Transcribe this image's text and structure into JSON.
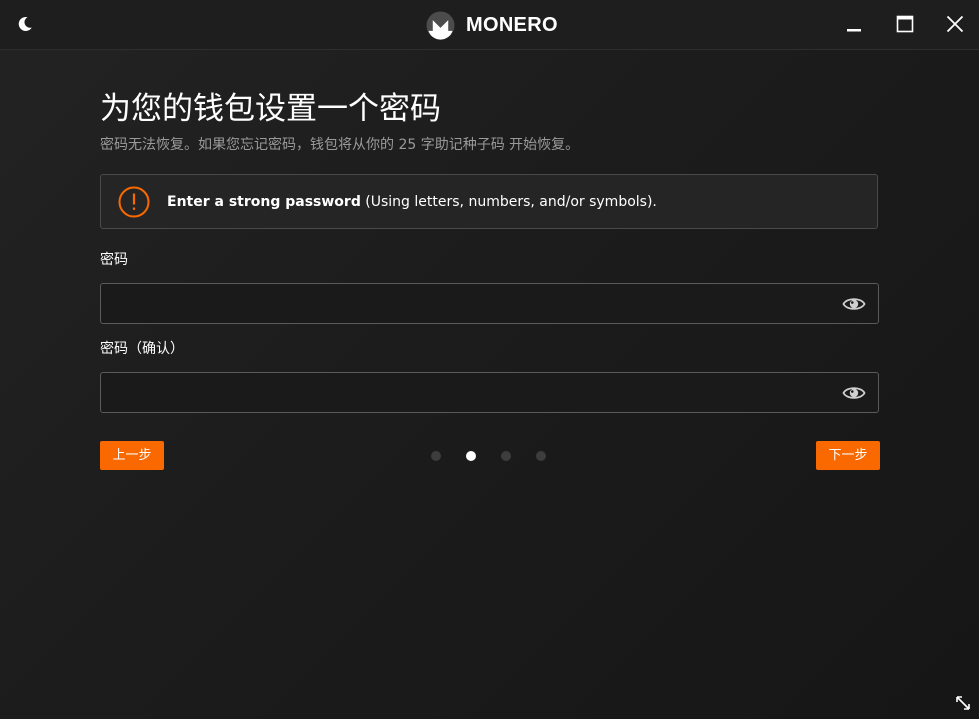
{
  "titlebar": {
    "app_name": "MONERO",
    "theme_icon": "moon-icon",
    "logo_icon": "monero-logo-icon",
    "window_controls": [
      "minimize-icon",
      "maximize-icon",
      "close-icon"
    ]
  },
  "page": {
    "title": "为您的钱包设置一个密码",
    "subtitle": "密码无法恢复。如果您忘记密码，钱包将从你的 25 字助记种子码 开始恢复。"
  },
  "notice": {
    "icon": "alert-circle-icon",
    "bold_text": "Enter a strong password",
    "rest_text": " (Using letters, numbers, and/or symbols)."
  },
  "password": {
    "label": "密码",
    "value": "",
    "toggle_icon": "eye-icon"
  },
  "password_confirm": {
    "label": "密码（确认）",
    "value": "",
    "toggle_icon": "eye-icon"
  },
  "navigation": {
    "prev_label": "上一步",
    "next_label": "下一步",
    "steps_total": 4,
    "current_step": 2
  },
  "colors": {
    "accent": "#fa6800",
    "background": "#1c1c1c",
    "muted_text": "#9a9a9a",
    "border": "#5a5a5a"
  },
  "resize_icon": "resize-diagonal-icon"
}
